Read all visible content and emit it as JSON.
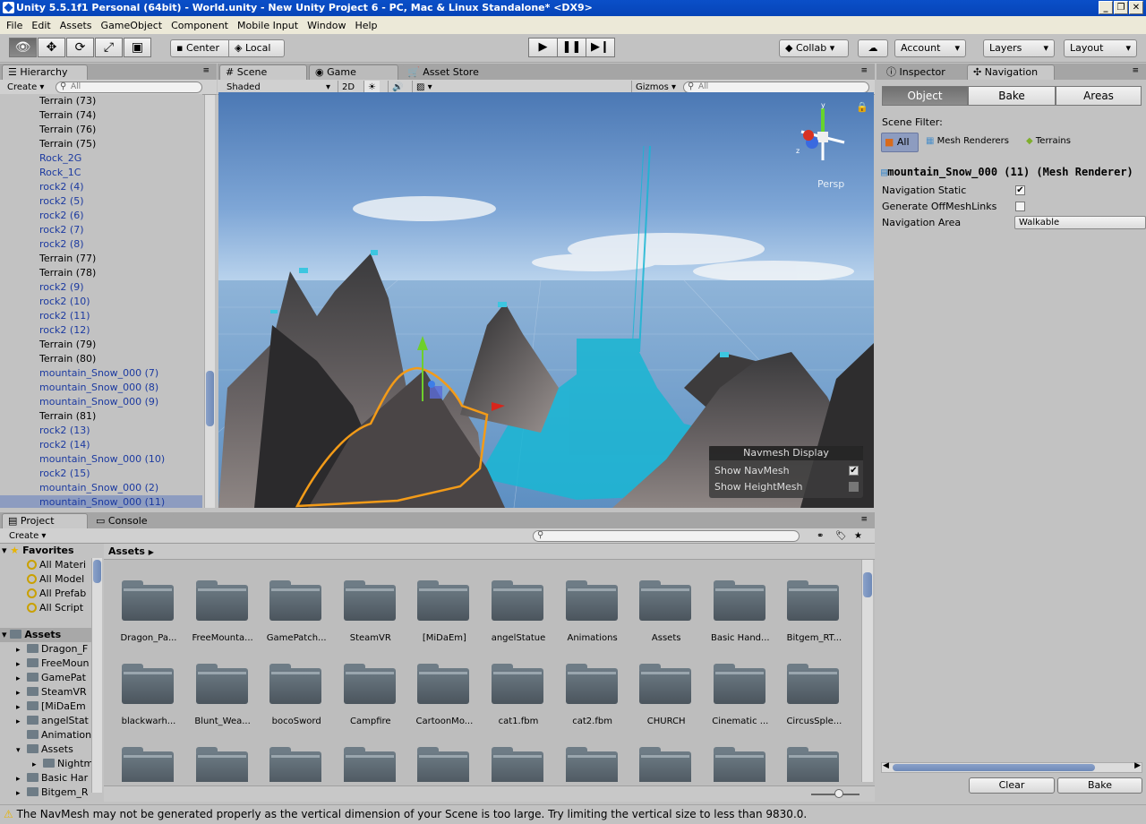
{
  "window": {
    "title": "Unity 5.5.1f1 Personal (64bit) - World.unity - New Unity Project 6 - PC, Mac & Linux Standalone* <DX9>"
  },
  "menu": [
    "File",
    "Edit",
    "Assets",
    "GameObject",
    "Component",
    "Mobile Input",
    "Window",
    "Help"
  ],
  "toolbar": {
    "center": "Center",
    "local": "Local",
    "collab": "Collab",
    "account": "Account",
    "layers": "Layers",
    "layout": "Layout"
  },
  "hierarchy": {
    "tab": "Hierarchy",
    "create": "Create",
    "search_placeholder": "All",
    "items": [
      {
        "label": "Terrain (73)",
        "prefab": false
      },
      {
        "label": "Terrain (74)",
        "prefab": false
      },
      {
        "label": "Terrain (76)",
        "prefab": false
      },
      {
        "label": "Terrain (75)",
        "prefab": false
      },
      {
        "label": "Rock_2G",
        "prefab": true
      },
      {
        "label": "Rock_1C",
        "prefab": true
      },
      {
        "label": "rock2 (4)",
        "prefab": true
      },
      {
        "label": "rock2 (5)",
        "prefab": true
      },
      {
        "label": "rock2 (6)",
        "prefab": true
      },
      {
        "label": "rock2 (7)",
        "prefab": true
      },
      {
        "label": "rock2 (8)",
        "prefab": true
      },
      {
        "label": "Terrain (77)",
        "prefab": false
      },
      {
        "label": "Terrain (78)",
        "prefab": false
      },
      {
        "label": "rock2 (9)",
        "prefab": true
      },
      {
        "label": "rock2 (10)",
        "prefab": true
      },
      {
        "label": "rock2 (11)",
        "prefab": true
      },
      {
        "label": "rock2 (12)",
        "prefab": true
      },
      {
        "label": "Terrain (79)",
        "prefab": false
      },
      {
        "label": "Terrain (80)",
        "prefab": false
      },
      {
        "label": "mountain_Snow_000 (7)",
        "prefab": true
      },
      {
        "label": "mountain_Snow_000 (8)",
        "prefab": true
      },
      {
        "label": "mountain_Snow_000 (9)",
        "prefab": true
      },
      {
        "label": "Terrain (81)",
        "prefab": false
      },
      {
        "label": "rock2 (13)",
        "prefab": true
      },
      {
        "label": "rock2 (14)",
        "prefab": true
      },
      {
        "label": "mountain_Snow_000 (10)",
        "prefab": true
      },
      {
        "label": "rock2 (15)",
        "prefab": true
      },
      {
        "label": "mountain_Snow_000 (2)",
        "prefab": true
      },
      {
        "label": "mountain_Snow_000 (11)",
        "prefab": true,
        "selected": true
      }
    ]
  },
  "scene": {
    "tabs": [
      "Scene",
      "Game",
      "Asset Store"
    ],
    "shading": "Shaded",
    "mode2d": "2D",
    "gizmos": "Gizmos",
    "search_placeholder": "All",
    "persp": "Persp",
    "navmesh_display": {
      "title": "Navmesh Display",
      "show_navmesh": "Show NavMesh",
      "show_heightmesh": "Show HeightMesh"
    }
  },
  "inspector": {
    "tabs": [
      "Inspector",
      "Navigation"
    ],
    "nav_tabs": [
      "Object",
      "Bake",
      "Areas"
    ],
    "scene_filter": "Scene Filter:",
    "filters": [
      "All",
      "Mesh Renderers",
      "Terrains"
    ],
    "object_name": "mountain_Snow_000 (11) (Mesh Renderer)",
    "nav_static": "Navigation Static",
    "gen_links": "Generate OffMeshLinks",
    "nav_area": "Navigation Area",
    "nav_area_value": "Walkable",
    "clear": "Clear",
    "bake": "Bake"
  },
  "project": {
    "tabs": [
      "Project",
      "Console"
    ],
    "create": "Create",
    "breadcrumb": "Assets",
    "favorites_label": "Favorites",
    "favorites": [
      "All Materi",
      "All Model",
      "All Prefab",
      "All Script"
    ],
    "assets_label": "Assets",
    "tree": [
      {
        "label": "Dragon_F",
        "indent": 1,
        "open": false
      },
      {
        "label": "FreeMoun",
        "indent": 1,
        "open": false
      },
      {
        "label": "GamePat",
        "indent": 1,
        "open": false
      },
      {
        "label": "SteamVR",
        "indent": 1,
        "open": false
      },
      {
        "label": "[MiDaEm",
        "indent": 1,
        "open": false
      },
      {
        "label": "angelStat",
        "indent": 1,
        "open": false
      },
      {
        "label": "Animation",
        "indent": 1,
        "open": null
      },
      {
        "label": "Assets",
        "indent": 1,
        "open": true
      },
      {
        "label": "Nightm",
        "indent": 2,
        "open": false
      },
      {
        "label": "Basic Har",
        "indent": 1,
        "open": false
      },
      {
        "label": "Bitgem_R",
        "indent": 1,
        "open": false
      }
    ],
    "folders": [
      "Dragon_Pa...",
      "FreeMounta...",
      "GamePatch...",
      "SteamVR",
      "[MiDaEm]",
      "angelStatue",
      "Animations",
      "Assets",
      "Basic Hand...",
      "Bitgem_RT...",
      "blackwarh...",
      "Blunt_Wea...",
      "bocoSword",
      "Campfire",
      "CartoonMo...",
      "cat1.fbm",
      "cat2.fbm",
      "CHURCH",
      "Cinematic ...",
      "CircusSple...",
      "",
      "",
      "",
      "",
      "",
      "",
      "",
      "",
      "",
      ""
    ]
  },
  "status": {
    "message": "The NavMesh may not be generated properly as the vertical dimension of your Scene is too large. Try limiting the vertical size to less than 9830.0."
  }
}
